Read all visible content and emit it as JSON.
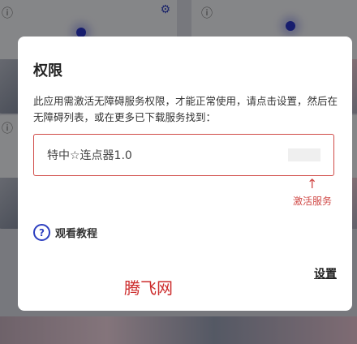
{
  "dialog": {
    "title": "权限",
    "description": "此应用需激活无障碍服务权限，才能正常使用，请点击设置，然后在无障碍列表，或在更多已下载服务找到：",
    "service_name": "特中☆连点器1.0",
    "activate_hint": "激活服务",
    "arrow_glyph": "↑",
    "tutorial_label": "观看教程",
    "settings_label": "设置",
    "watermark": "腾飞网"
  },
  "icons": {
    "help": "?",
    "info": "ⓘ",
    "gear": "⚙"
  },
  "colors": {
    "accent_red": "#d04a47",
    "icon_blue": "#2d3fc0"
  }
}
